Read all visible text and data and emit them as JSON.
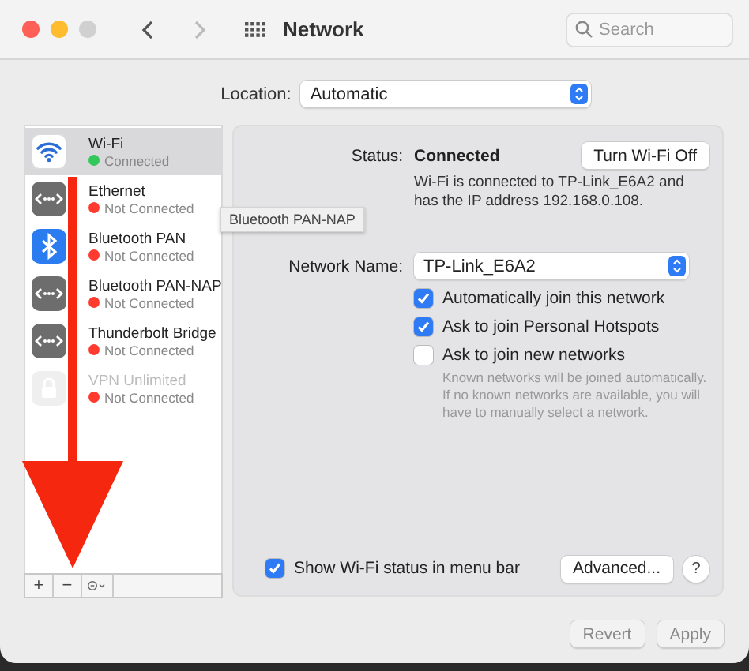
{
  "window": {
    "title": "Network",
    "search": {
      "placeholder": "Search"
    }
  },
  "location": {
    "label": "Location:",
    "value": "Automatic"
  },
  "services": [
    {
      "name": "Wi-Fi",
      "status": "Connected",
      "color": "#34c759",
      "selected": true,
      "disabled": false,
      "kind": "wifi"
    },
    {
      "name": "Ethernet",
      "status": "Not Connected",
      "color": "#ff3b30",
      "selected": false,
      "disabled": false,
      "kind": "ethernet"
    },
    {
      "name": "Bluetooth PAN",
      "status": "Not Connected",
      "color": "#ff3b30",
      "selected": false,
      "disabled": false,
      "kind": "bluetooth"
    },
    {
      "name": "Bluetooth PAN-NAP",
      "status": "Not Connected",
      "color": "#ff3b30",
      "selected": false,
      "disabled": false,
      "kind": "ethernet"
    },
    {
      "name": "Thunderbolt Bridge",
      "status": "Not Connected",
      "color": "#ff3b30",
      "selected": false,
      "disabled": false,
      "kind": "ethernet"
    },
    {
      "name": "VPN Unlimited",
      "status": "Not Connected",
      "color": "#ff3b30",
      "selected": false,
      "disabled": true,
      "kind": "vpn"
    }
  ],
  "tooltip": "Bluetooth PAN-NAP",
  "list_buttons": [
    "+",
    "−"
  ],
  "detail": {
    "status_label": "Status:",
    "status_value": "Connected",
    "toggle_button": "Turn Wi-Fi Off",
    "description": "Wi-Fi is connected to TP-Link_E6A2 and has the IP address 192.168.0.108.",
    "network_label": "Network Name:",
    "network_value": "TP-Link_E6A2",
    "options": [
      {
        "label": "Automatically join this network",
        "checked": true
      },
      {
        "label": "Ask to join Personal Hotspots",
        "checked": true
      },
      {
        "label": "Ask to join new networks",
        "checked": false
      }
    ],
    "note": "Known networks will be joined automatically. If no known networks are available, you will have to manually select a network.",
    "menu_bar": {
      "label": "Show Wi-Fi status in menu bar",
      "checked": true
    },
    "advanced_button": "Advanced...",
    "help_button": "?"
  },
  "footer": {
    "buttons": [
      "Revert",
      "Apply"
    ],
    "disabled": true
  }
}
